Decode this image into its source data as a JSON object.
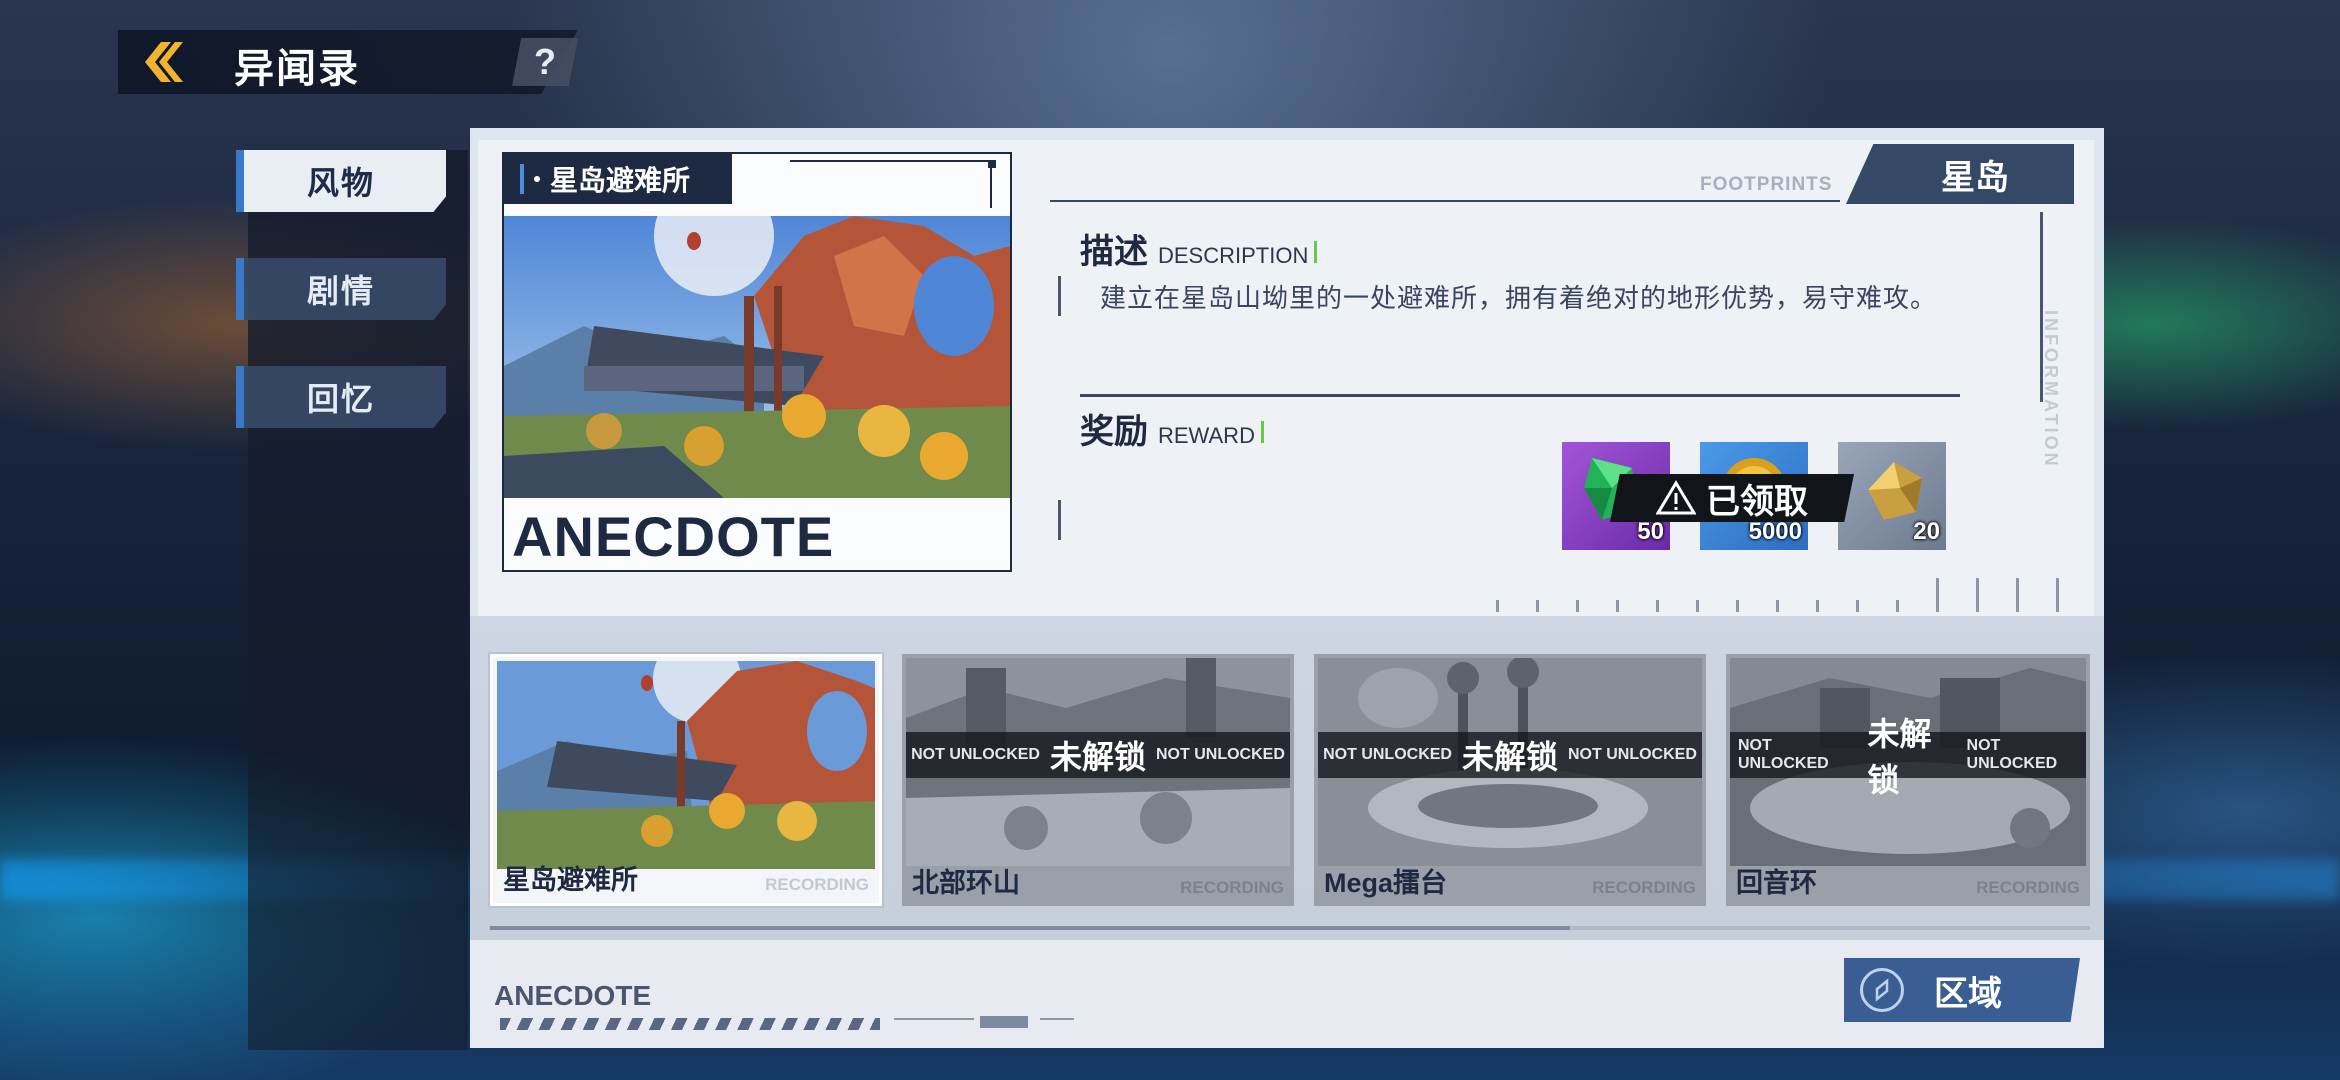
{
  "header": {
    "title": "异闻录",
    "help_label": "?"
  },
  "sidebar": {
    "tabs": [
      {
        "label": "风物",
        "active": true
      },
      {
        "label": "剧情",
        "active": false
      },
      {
        "label": "回忆",
        "active": false
      }
    ]
  },
  "feature": {
    "name": "星岛避难所",
    "watermark": "ANECDOTE"
  },
  "info": {
    "footprints": "FOOTPRINTS",
    "region": "星岛",
    "side_text": "INFORMATION",
    "description_title": "描述",
    "description_title_en": "DESCRIPTION",
    "description": "建立在星岛山坳里的一处避难所，拥有着绝对的地形优势，易守难攻。",
    "reward_title": "奖励",
    "reward_title_en": "REWARD",
    "claimed_label": "已领取",
    "rewards": [
      {
        "icon": "green-crystal-icon",
        "count": "50"
      },
      {
        "icon": "gold-coin-icon",
        "count": "5000"
      },
      {
        "icon": "gold-ore-icon",
        "count": "20"
      }
    ]
  },
  "locations": [
    {
      "name": "星岛避难所",
      "recording": "RECORDING",
      "locked": false
    },
    {
      "name": "北部环山",
      "recording": "RECORDING",
      "locked": true,
      "lock_small": "NOT UNLOCKED",
      "lock_big": "未解锁"
    },
    {
      "name": "Mega擂台",
      "recording": "RECORDING",
      "locked": true,
      "lock_small": "NOT UNLOCKED",
      "lock_big": "未解锁"
    },
    {
      "name": "回音环",
      "recording": "RECORDING",
      "locked": true,
      "lock_small": "NOT UNLOCKED",
      "lock_big": "未解锁"
    }
  ],
  "footer": {
    "anecdote": "ANECDOTE",
    "area_button": "区域"
  },
  "colors": {
    "accent_blue": "#3a5e94",
    "dark_navy": "#1d2a42",
    "reward_green": "#66cc44"
  }
}
